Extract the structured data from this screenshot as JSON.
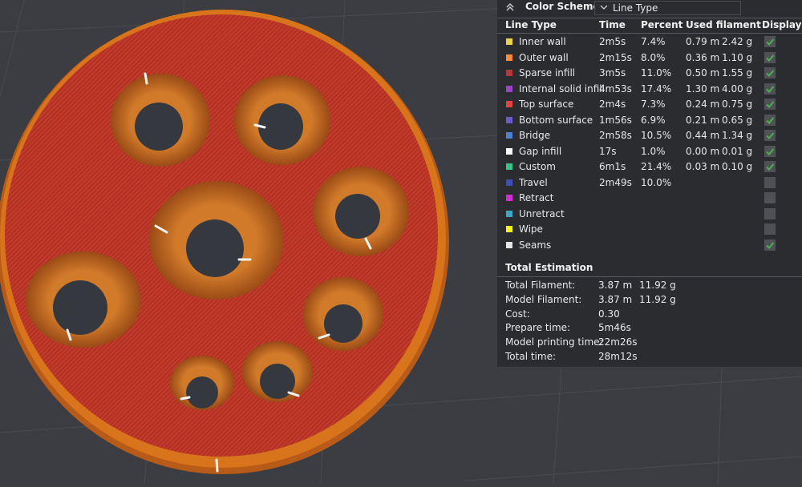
{
  "legend": {
    "title": "Color Scheme",
    "scheme_value": "Line Type",
    "headers": {
      "line_type": "Line Type",
      "time": "Time",
      "percent": "Percent",
      "used_filament": "Used filament",
      "display": "Display"
    },
    "rows": [
      {
        "name": "Inner wall",
        "color": "#f0d24a",
        "time": "2m5s",
        "percent": "7.4%",
        "length": "0.79 m",
        "weight": "2.42 g",
        "display": true
      },
      {
        "name": "Outer wall",
        "color": "#ff8c2e",
        "time": "2m15s",
        "percent": "8.0%",
        "length": "0.36 m",
        "weight": "1.10 g",
        "display": true
      },
      {
        "name": "Sparse infill",
        "color": "#b73838",
        "time": "3m5s",
        "percent": "11.0%",
        "length": "0.50 m",
        "weight": "1.55 g",
        "display": true
      },
      {
        "name": "Internal solid infill",
        "color": "#9a45c9",
        "time": "4m53s",
        "percent": "17.4%",
        "length": "1.30 m",
        "weight": "4.00 g",
        "display": true
      },
      {
        "name": "Top surface",
        "color": "#e64141",
        "time": "2m4s",
        "percent": "7.3%",
        "length": "0.24 m",
        "weight": "0.75 g",
        "display": true
      },
      {
        "name": "Bottom surface",
        "color": "#6a5acd",
        "time": "1m56s",
        "percent": "6.9%",
        "length": "0.21 m",
        "weight": "0.65 g",
        "display": true
      },
      {
        "name": "Bridge",
        "color": "#4f7fcf",
        "time": "2m58s",
        "percent": "10.5%",
        "length": "0.44 m",
        "weight": "1.34 g",
        "display": true
      },
      {
        "name": "Gap infill",
        "color": "#ffffff",
        "time": "17s",
        "percent": "1.0%",
        "length": "0.00 m",
        "weight": "0.01 g",
        "display": true
      },
      {
        "name": "Custom",
        "color": "#36c48a",
        "time": "6m1s",
        "percent": "21.4%",
        "length": "0.03 m",
        "weight": "0.10 g",
        "display": true
      },
      {
        "name": "Travel",
        "color": "#3d4fb5",
        "time": "2m49s",
        "percent": "10.0%",
        "length": "",
        "weight": "",
        "display": false
      },
      {
        "name": "Retract",
        "color": "#d62ad6",
        "time": "",
        "percent": "",
        "length": "",
        "weight": "",
        "display": false
      },
      {
        "name": "Unretract",
        "color": "#3aa7c9",
        "time": "",
        "percent": "",
        "length": "",
        "weight": "",
        "display": false
      },
      {
        "name": "Wipe",
        "color": "#f4f41d",
        "time": "",
        "percent": "",
        "length": "",
        "weight": "",
        "display": false
      },
      {
        "name": "Seams",
        "color": "#e6e6e6",
        "time": "",
        "percent": "",
        "length": "",
        "weight": "",
        "display": true
      }
    ],
    "total_title": "Total Estimation",
    "stats": [
      {
        "label": "Total Filament:",
        "v1": "3.87 m",
        "v2": "11.92 g"
      },
      {
        "label": "Model Filament:",
        "v1": "3.87 m",
        "v2": "11.92 g"
      },
      {
        "label": "Cost:",
        "v1": "0.30",
        "v2": ""
      },
      {
        "label": "Prepare time:",
        "v1": "5m46s",
        "v2": ""
      },
      {
        "label": "Model printing time:",
        "v1": "22m26s",
        "v2": ""
      },
      {
        "label": "Total time:",
        "v1": "28m12s",
        "v2": ""
      }
    ]
  },
  "colors": {
    "background": "#3b3d42",
    "panel": "#2b2c30",
    "plate_surface": "#c23a2a",
    "plate_wall": "#d8741c",
    "checkbox_on": "#4caf50"
  }
}
